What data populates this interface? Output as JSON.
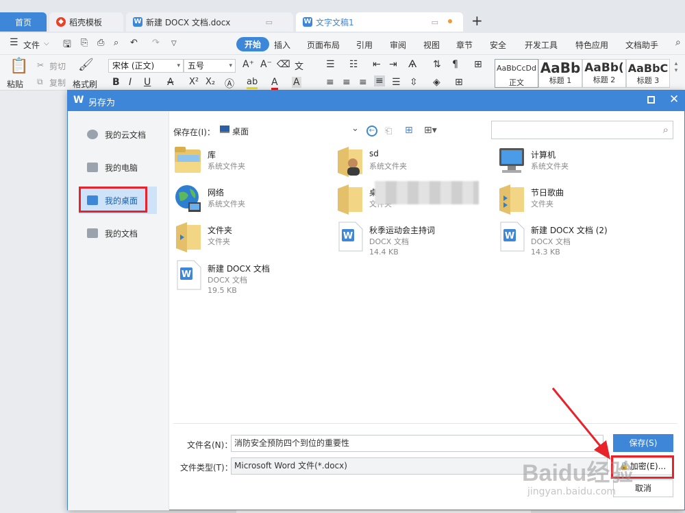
{
  "tabs": {
    "home": "首页",
    "template": "稻壳模板",
    "doc1": "新建 DOCX 文档.docx",
    "doc2": "文字文稿1",
    "add": "+"
  },
  "menu": {
    "file": "文件",
    "start": "开始",
    "items": [
      "插入",
      "页面布局",
      "引用",
      "审阅",
      "视图",
      "章节",
      "安全",
      "开发工具",
      "特色应用",
      "文档助手"
    ]
  },
  "ribbon": {
    "paste": "粘贴",
    "cut": "剪切",
    "copy": "复制",
    "format_painter": "格式刷",
    "font_name": "宋体 (正文)",
    "font_size": "五号",
    "styles": [
      {
        "preview": "AaBbCcDd",
        "label": "正文"
      },
      {
        "preview": "AaBb",
        "label": "标题 1"
      },
      {
        "preview": "AaBb(",
        "label": "标题 2"
      },
      {
        "preview": "AaBbC",
        "label": "标题 3"
      }
    ]
  },
  "dialog": {
    "title": "另存为",
    "sidebar": [
      "我的云文档",
      "我的电脑",
      "我的桌面",
      "我的文档"
    ],
    "save_in_label": "保存在(I)：",
    "save_in_value": "桌面",
    "search_placeholder": "",
    "files": [
      {
        "name": "库",
        "type": "系统文件夹",
        "size": "",
        "icon": "library-folder-icon"
      },
      {
        "name": "sd",
        "type": "系统文件夹",
        "size": "",
        "icon": "user-folder-icon"
      },
      {
        "name": "计算机",
        "type": "系统文件夹",
        "size": "",
        "icon": "computer-icon"
      },
      {
        "name": "网络",
        "type": "系统文件夹",
        "size": "",
        "icon": "network-icon"
      },
      {
        "name": "桌",
        "type": "文件夹",
        "size": "",
        "icon": "folder-icon"
      },
      {
        "name": "节日歌曲",
        "type": "文件夹",
        "size": "",
        "icon": "folder-icon"
      },
      {
        "name": "文件夹",
        "type": "文件夹",
        "size": "",
        "icon": "folder-icon"
      },
      {
        "name": "秋季运动会主持词",
        "type": "DOCX 文档",
        "size": "14.4 KB",
        "icon": "docx-icon"
      },
      {
        "name": "新建 DOCX 文档 (2)",
        "type": "DOCX 文档",
        "size": "14.3 KB",
        "icon": "docx-icon"
      },
      {
        "name": "新建 DOCX 文档",
        "type": "DOCX 文档",
        "size": "19.5 KB",
        "icon": "docx-icon"
      }
    ],
    "filename_label": "文件名(N)：",
    "filename_value": "消防安全预防四个到位的重要性",
    "filetype_label": "文件类型(T)：",
    "filetype_value": "Microsoft Word 文件(*.docx)",
    "save_button": "保存(S)",
    "encrypt_button": "加密(E)...",
    "cancel_button": "取消"
  },
  "watermark": {
    "line1": "Baidu经验",
    "line2": "jingyan.baidu.com"
  },
  "colors": {
    "accent": "#3d86d8",
    "highlight": "#e8222a",
    "selected": "#cfe3f8"
  }
}
